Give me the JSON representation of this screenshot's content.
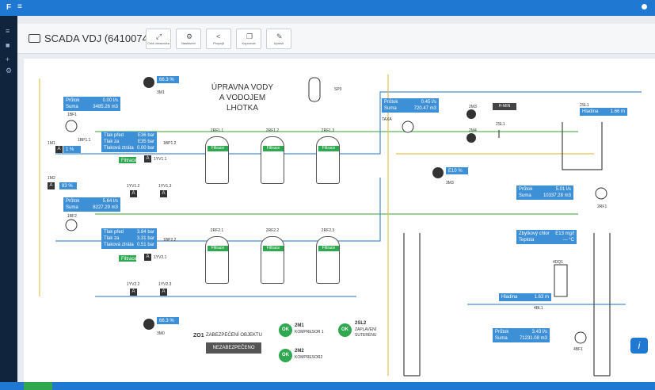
{
  "app": {
    "logo": "F",
    "menu": "≡"
  },
  "header": {
    "title": "SCADA VDJ (64100749)",
    "buttons": [
      {
        "label": "Celá obrazovka",
        "icon": "expand-icon"
      },
      {
        "label": "Nastavení",
        "icon": "gears-icon"
      },
      {
        "label": "Propojit",
        "icon": "share-icon"
      },
      {
        "label": "Kopírovat",
        "icon": "copy-icon"
      },
      {
        "label": "Upravit",
        "icon": "edit-icon"
      }
    ]
  },
  "plant": {
    "title_line1": "ÚPRAVNA VODY",
    "title_line2": "A VODOJEM LHOTKA"
  },
  "flow1": {
    "label_prutok": "Průtok",
    "value_prutok": "0.00",
    "unit_prutok": "l/s",
    "label_suma": "Suma",
    "value_suma": "3485.26",
    "unit_suma": "m3",
    "meter": "1BF1"
  },
  "flow2": {
    "label_prutok": "Průtok",
    "value_prutok": "5.64",
    "unit_prutok": "l/s",
    "label_suma": "Suma",
    "value_suma": "8227.29",
    "unit_suma": "m3",
    "meter": "1BF2"
  },
  "pump3m1": {
    "pct": "66.3",
    "unit": "%",
    "name": "3M1"
  },
  "pump3m0": {
    "pct": "66.3",
    "unit": "%",
    "name": "3M0"
  },
  "pump3m3": {
    "pct": "E10",
    "unit": "%",
    "name": "3M3"
  },
  "valves": {
    "m1": "1M1",
    "m1pct": "1",
    "m2": "1M2",
    "m2pct": "83",
    "unit": "%"
  },
  "line1": {
    "label1": "Tlak před",
    "value1": "E36",
    "label2": "Tlak za",
    "value2": "E35",
    "label3": "Tlaková ztráta",
    "value3": "0.00",
    "unit": "bar",
    "sensor": "1BP1.1",
    "sensor2": "1BP1.2",
    "valve": "1YV1.1",
    "valve2": "1YV1.2",
    "valve3": "1YV1.3",
    "filter_label": "Filtrace"
  },
  "line2": {
    "label1": "Tlak před",
    "value1": "3.84",
    "label2": "Tlak za",
    "value2": "3.31",
    "label3": "Tlaková ztráta",
    "value3": "0.51",
    "unit": "bar",
    "sensor": "1BP2.2",
    "valve": "1YV2.1",
    "valve2": "1YV2.2",
    "valve3": "1YV2.3",
    "filter_label": "Filtrace"
  },
  "filters_top": [
    {
      "name": "2RF1.1",
      "badge": "Filtrace"
    },
    {
      "name": "2RF1.2",
      "badge": "Filtrace"
    },
    {
      "name": "2RF1.3",
      "badge": "Filtrace"
    }
  ],
  "filters_bottom": [
    {
      "name": "2RF2.1",
      "badge": "Filtrace"
    },
    {
      "name": "2RF2.2",
      "badge": "Filtrace"
    },
    {
      "name": "2RF2.3",
      "badge": "Filtrace"
    }
  ],
  "flow3": {
    "label_prutok": "Průtok",
    "value_prutok": "0.45",
    "unit_prutok": "l/s",
    "label_suma": "Suma",
    "value_suma": "720.47",
    "unit_suma": "m3",
    "meter": "TAXA"
  },
  "flow4": {
    "label_prutok": "Průtok",
    "value_prutok": "5.01",
    "unit_prutok": "l/s",
    "label_suma": "Suma",
    "value_suma": "10337.28",
    "unit_suma": "m3",
    "meter": "2RF1"
  },
  "flow5": {
    "label_prutok": "Průtok",
    "value_prutok": "3.43",
    "unit_prutok": "l/s",
    "label_suma": "Suma",
    "value_suma": "71231.08",
    "unit_suma": "m3",
    "meter": "4BF1"
  },
  "tank": {
    "hmin": "H-MIN",
    "sensor": "2SL1",
    "level_label": "Hladina",
    "level_value": "1.66",
    "unit": "m",
    "sensor2": "2SL1"
  },
  "reservoir": {
    "label1": "Zbytkový chlor",
    "value1": "E13",
    "unit1": "mg/l",
    "label2": "Teplota",
    "value2": "---",
    "unit2": "°C",
    "level_label": "Hladina",
    "level_value": "1.63",
    "level_unit": "m",
    "sensor": "4BL1",
    "device": "4DQ1"
  },
  "pumps": {
    "p1": "2M3",
    "p2": "2M4"
  },
  "status": {
    "zo1": "ZO1",
    "zo1_text": "ZABEZPEČENÍ OBJEKTU",
    "nezab": "NEZABEZPEČENO",
    "m1": "2M1",
    "m1_text": "KOMPRESOR 1",
    "m2": "2M2",
    "m2_text": "KOMPRESOR2",
    "sl2": "2SL2",
    "sl2_text1": "ZAPLAVENÍ",
    "sl2_text2": "SUTERÉNU",
    "ok": "OK"
  },
  "labels": {
    "sp3": "SP3",
    "a": "A",
    "info": "i"
  },
  "colors": {
    "accent": "#1f78d1",
    "panel": "#3e90d6",
    "ok": "#2fa84f",
    "pipe_green": "#5ab95a",
    "pipe_blue": "#4a8fd0",
    "pipe_yellow": "#e5c04a"
  }
}
